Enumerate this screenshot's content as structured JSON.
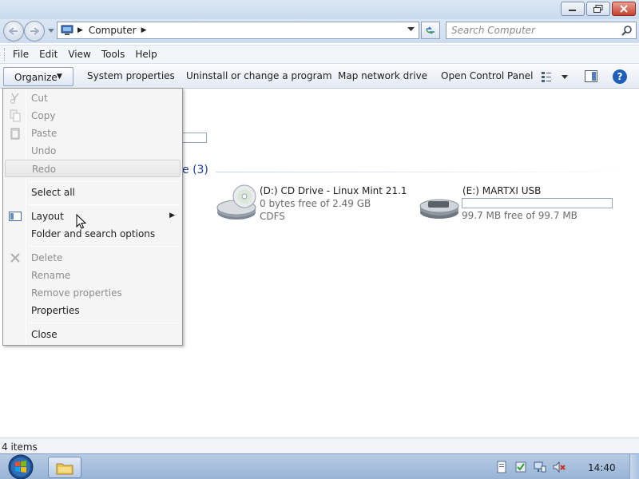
{
  "window": {
    "minimize_icon": "minimize-icon",
    "maximize_icon": "restore-icon",
    "close_icon": "close-icon"
  },
  "address": {
    "location_icon": "computer-icon",
    "crumb": "Computer",
    "search_placeholder": "Search Computer"
  },
  "menubar": {
    "items": [
      "File",
      "Edit",
      "View",
      "Tools",
      "Help"
    ]
  },
  "commandbar": {
    "organize": "Organize",
    "system_properties": "System properties",
    "uninstall": "Uninstall or change a program",
    "map_drive": "Map network drive",
    "control_panel": "Open Control Panel",
    "help_glyph": "?"
  },
  "content": {
    "group_header_partial": "e (3)",
    "drives": [
      {
        "name": "(D:) CD Drive - Linux Mint 21.1",
        "free": "0 bytes free of 2.49 GB",
        "fs": "CDFS",
        "icon": "cd-drive-icon"
      },
      {
        "name": "(E:) MARTXI USB",
        "free": "99.7 MB free of 99.7 MB",
        "icon": "usb-drive-icon",
        "used_fraction": 0
      }
    ]
  },
  "organize_menu": {
    "cut": "Cut",
    "copy": "Copy",
    "paste": "Paste",
    "undo": "Undo",
    "redo": "Redo",
    "select_all": "Select all",
    "layout": "Layout",
    "folder_options": "Folder and search options",
    "delete": "Delete",
    "rename": "Rename",
    "remove_properties": "Remove properties",
    "properties": "Properties",
    "close": "Close"
  },
  "status": {
    "items": "4 items"
  },
  "taskbar": {
    "clock": "14:40"
  },
  "colors": {
    "accent": "#1f5fb9",
    "group_header": "#1e3f8f"
  }
}
